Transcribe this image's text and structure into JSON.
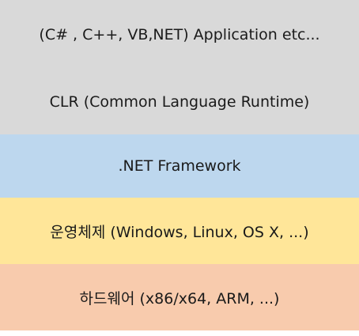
{
  "layers": [
    {
      "id": "application",
      "label": "(C# , C++, VB,NET) Application etc...",
      "color": "#d9d9d9"
    },
    {
      "id": "clr",
      "label": "CLR (Common Language Runtime)",
      "color": "#d9d9d9"
    },
    {
      "id": "net-framework",
      "label": ".NET Framework",
      "color": "#bdd7ee"
    },
    {
      "id": "operating-system",
      "label": "운영체제 (Windows, Linux, OS X, ...)",
      "color": "#ffe699"
    },
    {
      "id": "hardware",
      "label": "하드웨어 (x86/x64, ARM, ...)",
      "color": "#f8cbad"
    }
  ]
}
